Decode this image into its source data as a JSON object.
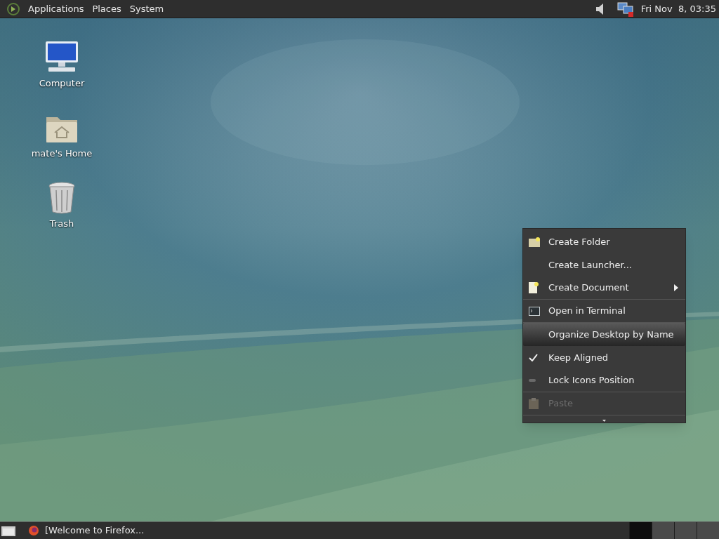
{
  "top_panel": {
    "menus": [
      "Applications",
      "Places",
      "System"
    ],
    "clock": "Fri Nov  8, 03:35"
  },
  "desktop_icons": [
    {
      "label": "Computer",
      "kind": "computer"
    },
    {
      "label": "mate's Home",
      "kind": "home"
    },
    {
      "label": "Trash",
      "kind": "trash"
    }
  ],
  "context_menu": {
    "items": [
      {
        "label": "Create Folder",
        "kind": "folder",
        "selected": false,
        "disabled": false,
        "submenu": false,
        "separator_after": false
      },
      {
        "label": "Create Launcher...",
        "kind": "plain",
        "selected": false,
        "disabled": false,
        "submenu": false,
        "separator_after": false
      },
      {
        "label": "Create Document",
        "kind": "document",
        "selected": false,
        "disabled": false,
        "submenu": true,
        "separator_after": true
      },
      {
        "label": "Open in Terminal",
        "kind": "terminal",
        "selected": false,
        "disabled": false,
        "submenu": false,
        "separator_after": true
      },
      {
        "label": "Organize Desktop by Name",
        "kind": "plain",
        "selected": true,
        "disabled": false,
        "submenu": false,
        "separator_after": false
      },
      {
        "label": "Keep Aligned",
        "kind": "check",
        "checked": true,
        "selected": false,
        "disabled": false,
        "submenu": false,
        "separator_after": false
      },
      {
        "label": "Lock Icons Position",
        "kind": "check",
        "checked": false,
        "selected": false,
        "disabled": false,
        "submenu": false,
        "separator_after": true
      },
      {
        "label": "Paste",
        "kind": "paste",
        "selected": false,
        "disabled": true,
        "submenu": false,
        "separator_after": true
      }
    ]
  },
  "bottom_panel": {
    "tasks": [
      {
        "label": "[Welcome to Firefox...",
        "selected": false
      }
    ],
    "workspaces": [
      {
        "selected": true
      },
      {
        "selected": false
      },
      {
        "selected": false
      },
      {
        "selected": false
      }
    ]
  }
}
